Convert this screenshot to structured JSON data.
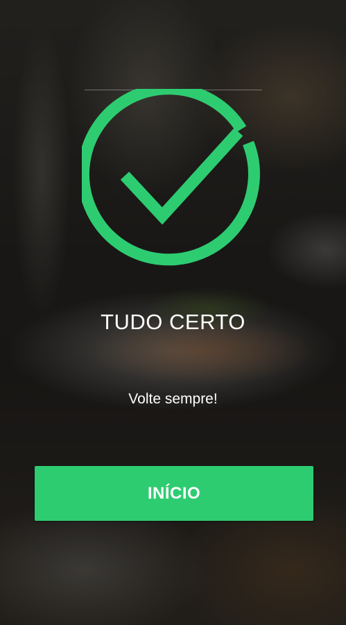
{
  "success": {
    "title": "TUDO CERTO",
    "message": "Volte sempre!",
    "icon": "check-circle-icon"
  },
  "actions": {
    "start_label": "INÍCIO"
  },
  "colors": {
    "accent": "#2ecc71",
    "text": "#ffffff"
  }
}
